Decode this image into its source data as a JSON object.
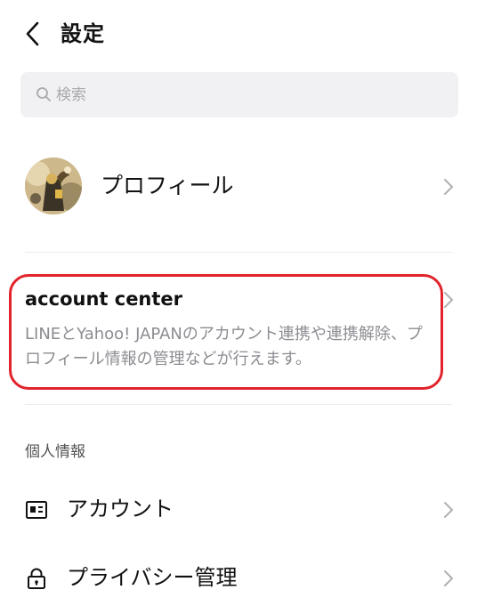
{
  "header": {
    "title": "設定"
  },
  "search": {
    "placeholder": "検索"
  },
  "profile": {
    "label": "プロフィール"
  },
  "account_center": {
    "title": "account center",
    "description": "LINEとYahoo! JAPANのアカウント連携や連携解除、プロフィール情報の管理などが行えます。",
    "highlight_color": "#e1232c"
  },
  "personal_info": {
    "section_title": "個人情報",
    "items": [
      {
        "label": "アカウント",
        "icon": "id-card-icon"
      },
      {
        "label": "プライバシー管理",
        "icon": "lock-icon"
      }
    ]
  },
  "colors": {
    "text_primary": "#111111",
    "text_secondary": "#8c8c92",
    "search_bg": "#f1f1f3",
    "chevron": "#b0b0b5"
  }
}
